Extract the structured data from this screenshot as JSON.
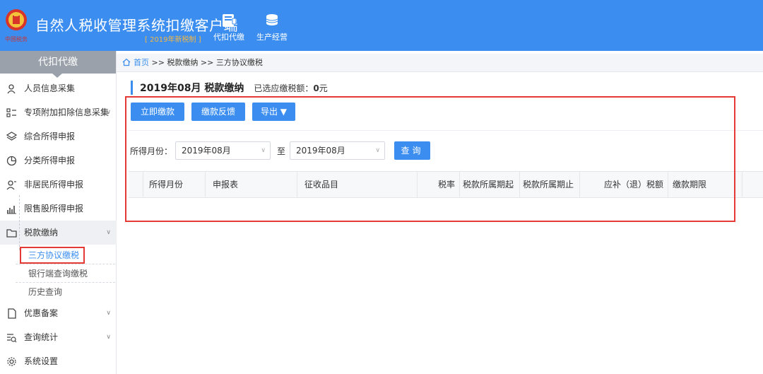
{
  "header": {
    "title": "自然人税收管理系统扣缴客户端",
    "subtitle": "[ 2019年新税制 ]",
    "nav": [
      {
        "label": "代扣代缴",
        "icon": "ledger-icon"
      },
      {
        "label": "生产经营",
        "icon": "coins-icon"
      }
    ]
  },
  "sidebar": {
    "heading": "代扣代缴",
    "items": [
      {
        "label": "人员信息采集",
        "icon": "person-icon"
      },
      {
        "label": "专项附加扣除信息采集",
        "icon": "list-icon"
      },
      {
        "label": "综合所得申报",
        "icon": "layers-icon"
      },
      {
        "label": "分类所得申报",
        "icon": "pie-icon"
      },
      {
        "label": "非居民所得申报",
        "icon": "user-icon"
      },
      {
        "label": "限售股所得申报",
        "icon": "bar-chart-icon"
      },
      {
        "label": "税款缴纳",
        "icon": "folder-icon"
      },
      {
        "label": "优惠备案",
        "icon": "doc-icon"
      },
      {
        "label": "查询统计",
        "icon": "search-list-icon"
      },
      {
        "label": "系统设置",
        "icon": "gear-icon"
      }
    ],
    "subitems": [
      "三方协议缴税",
      "银行端查询缴税",
      "历史查询"
    ]
  },
  "breadcrumb": {
    "home": "首页",
    "rest": " >> 税款缴纳 >> 三方协议缴税"
  },
  "main": {
    "title": "2019年08月 税款缴纳",
    "amount_label": "已选应缴税额：",
    "amount_value": "0",
    "amount_unit": "元",
    "buttons": {
      "pay_now": "立即缴款",
      "feedback": "缴款反馈",
      "export": "导出 ▼"
    },
    "query": {
      "label": "所得月份：",
      "from": "2019年08月",
      "to_label": "至",
      "to": "2019年08月",
      "button": "查询"
    },
    "table": {
      "columns": [
        "所得月份",
        "申报表",
        "征收品目",
        "税率",
        "税款所属期起",
        "税款所属期止",
        "应补（退）税额",
        "缴款期限"
      ]
    }
  },
  "colors": {
    "primary": "#3b8ef0",
    "highlight": "#e53935",
    "accent_text": "#f5b642"
  }
}
